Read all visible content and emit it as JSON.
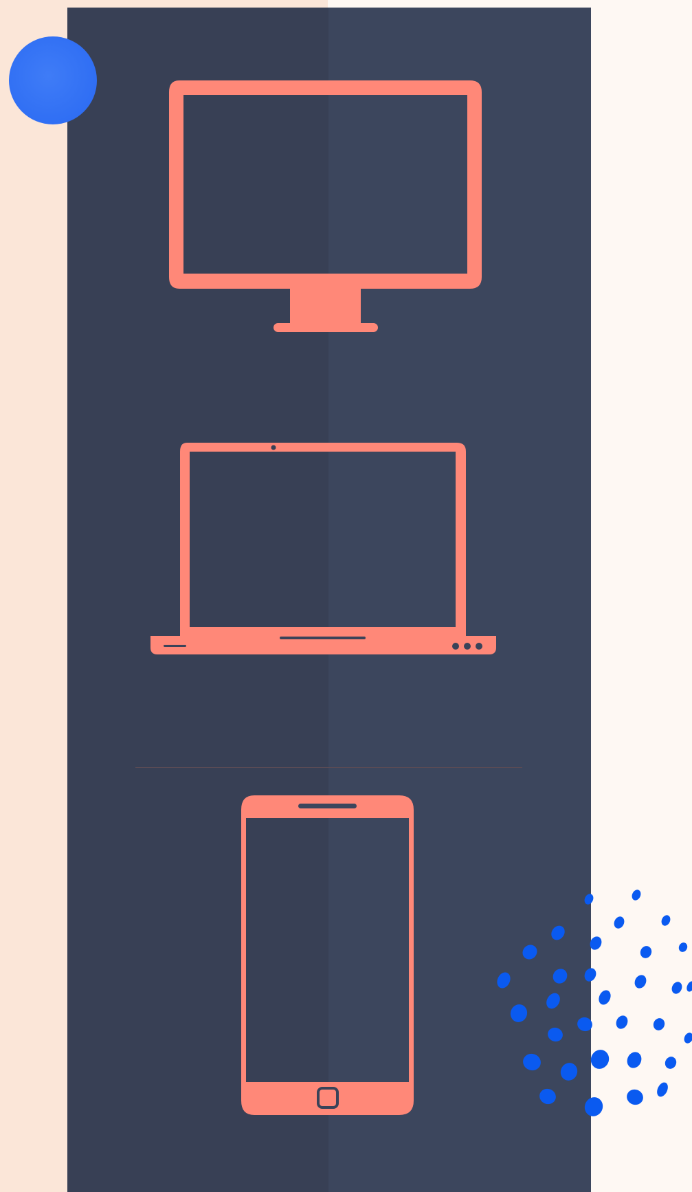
{
  "colors": {
    "background_left": "#FBE6D8",
    "background_right": "#FEF8F3",
    "panel_left": "#384055",
    "panel_right": "#3C465D",
    "device_fill": "#FF8878",
    "accent_blue": "#0A5AF0",
    "blob_blue": "#3374F5"
  },
  "icons": {
    "monitor": "desktop-monitor-icon",
    "laptop": "laptop-icon",
    "phone": "smartphone-icon"
  }
}
